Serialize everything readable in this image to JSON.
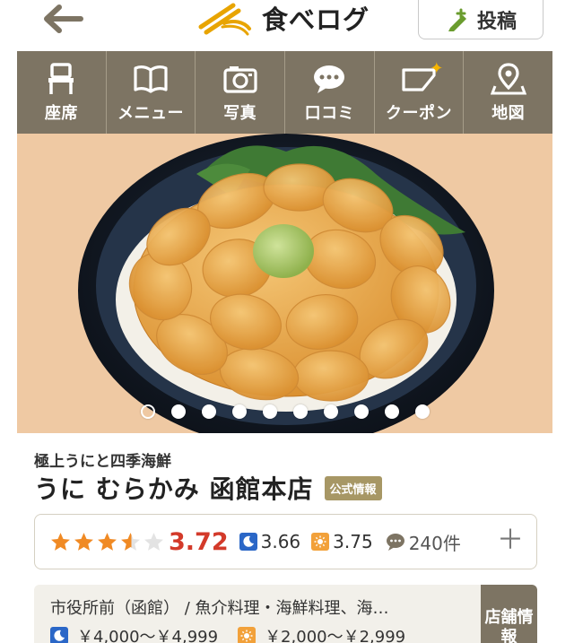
{
  "header": {
    "logo_text": "食べログ",
    "post_label": "投稿"
  },
  "nav": {
    "items": [
      {
        "label": "座席",
        "icon": "chair-icon"
      },
      {
        "label": "メニュー",
        "icon": "book-icon"
      },
      {
        "label": "写真",
        "icon": "camera-icon"
      },
      {
        "label": "口コミ",
        "icon": "speech-bubble-icon"
      },
      {
        "label": "クーポン",
        "icon": "coupon-icon"
      },
      {
        "label": "地図",
        "icon": "map-pin-icon"
      }
    ]
  },
  "hero": {
    "slide_count": 10,
    "active_slide": 1
  },
  "restaurant": {
    "subtitle": "極上うにと四季海鮮",
    "name": "うに むらかみ 函館本店",
    "official_badge": "公式情報"
  },
  "rating": {
    "stars": 3.72,
    "score": "3.72",
    "dinner_score": "3.66",
    "lunch_score": "3.75",
    "review_count": "240件"
  },
  "info": {
    "station_genre": "市役所前（函館） / 魚介料理・海鮮料理、海…",
    "dinner_budget": "￥4,000～￥4,999",
    "lunch_budget": "￥2,000～￥2,999",
    "store_info_label": "店舗情報"
  },
  "colors": {
    "nav_bg": "#7d7463",
    "score_red": "#d33a2a",
    "star_orange": "#f08a24",
    "dinner_blue": "#2b67c7",
    "lunch_orange": "#f2a13a",
    "badge_gold": "#a79765"
  }
}
